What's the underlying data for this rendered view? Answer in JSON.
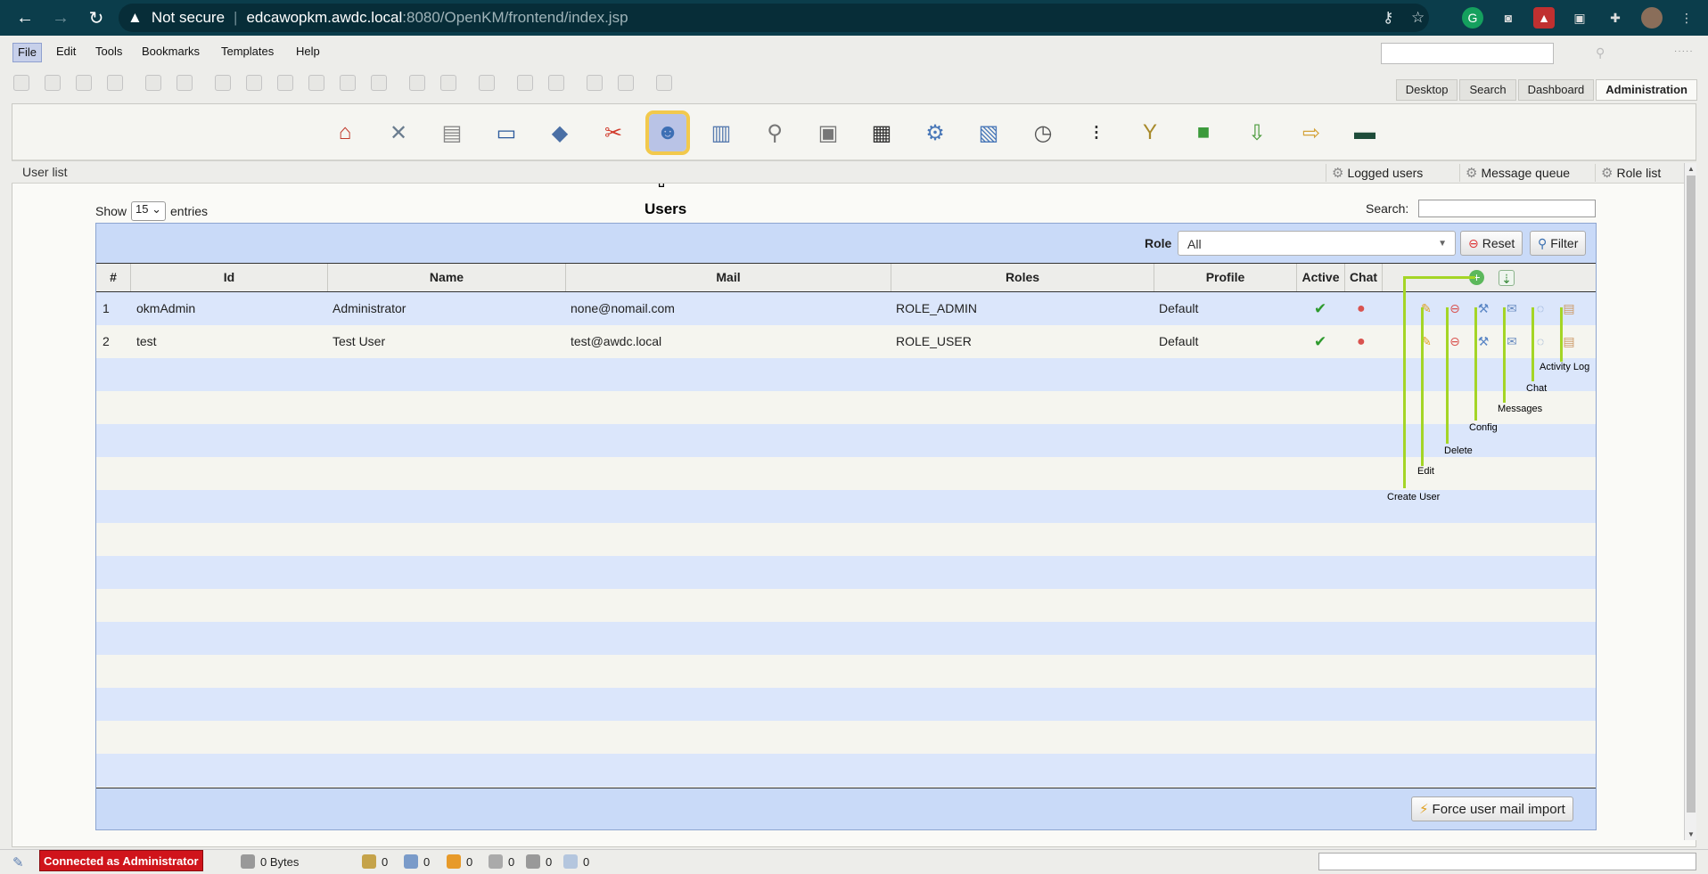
{
  "browser": {
    "security_label": "Not secure",
    "url_host": "edcawopkm.awdc.local",
    "url_path": ":8080/OpenKM/frontend/index.jsp"
  },
  "menu": {
    "items": [
      "File",
      "Edit",
      "Tools",
      "Bookmarks",
      "Templates",
      "Help"
    ]
  },
  "tabs": [
    "Desktop",
    "Search",
    "Dashboard",
    "Administration"
  ],
  "admin": {
    "selected_tool_label": "Users",
    "breadcrumb": "User list",
    "links": [
      "Logged users",
      "Message queue",
      "Role list"
    ]
  },
  "table": {
    "show_label": "Show",
    "entries_value": "15",
    "entries_label": "entries",
    "search_label": "Search:",
    "role_label": "Role",
    "role_value": "All",
    "reset_label": "Reset",
    "filter_label": "Filter",
    "columns": [
      "#",
      "Id",
      "Name",
      "Mail",
      "Roles",
      "Profile",
      "Active",
      "Chat"
    ],
    "rows": [
      {
        "num": "1",
        "id": "okmAdmin",
        "name": "Administrator",
        "mail": "none@nomail.com",
        "roles": "ROLE_ADMIN",
        "profile": "Default"
      },
      {
        "num": "2",
        "id": "test",
        "name": "Test User",
        "mail": "test@awdc.local",
        "roles": "ROLE_USER",
        "profile": "Default"
      }
    ],
    "force_import_label": "Force user mail import"
  },
  "annotations": {
    "create_user": "Create User",
    "edit": "Edit",
    "delete": "Delete",
    "config": "Config",
    "messages": "Messages",
    "chat": "Chat",
    "activity_log": "Activity Log"
  },
  "status": {
    "connected": "Connected as Administrator",
    "size": "0 Bytes",
    "counters": [
      "0",
      "0",
      "0",
      "0",
      "0",
      "0"
    ]
  },
  "colors": {
    "chrome_bg": "#0b3d4b",
    "table_header": "#c9daf8",
    "row_alt": "#dbe6fb",
    "connected_bg": "#d0141b",
    "annotation_line": "#a4d526",
    "selected_outline": "#f2c94c"
  }
}
